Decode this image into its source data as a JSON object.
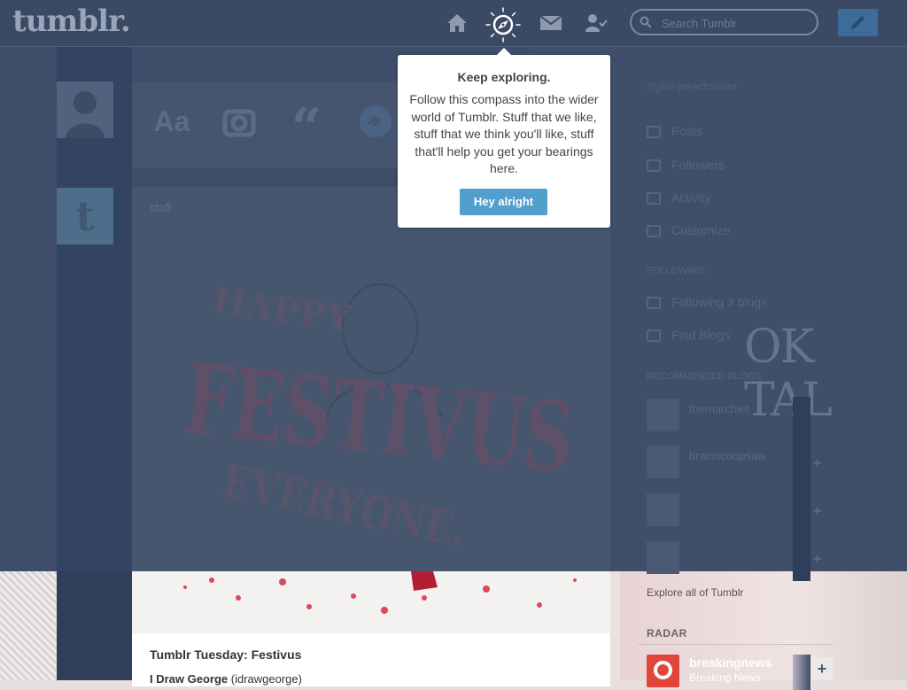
{
  "header": {
    "logo": "tumblr.",
    "search_placeholder": "Search Tumblr"
  },
  "nav": {
    "icons": [
      "home-icon",
      "explore-compass-icon",
      "messages-envelope-icon",
      "account-people-icon",
      "compose-pencil-icon"
    ]
  },
  "popover": {
    "title": "Keep exploring.",
    "body": "Follow this compass into the wider world of Tumblr. Stuff that we like, stuff that we think you'll like, stuff that'll help you get your bearings here.",
    "button": "Hey alright"
  },
  "dashboard": {
    "post_types": [
      "Aa",
      "“"
    ],
    "post": {
      "author_short": "staff",
      "image_text": [
        "HAPPY",
        "FESTIVUS",
        "EVERYONE."
      ],
      "title": "Tumblr Tuesday: Festivus",
      "author_name": "I Draw George",
      "author_handle": "(idrawgeorge)"
    }
  },
  "sidebar": {
    "blog_name": "stylishpeachsister",
    "items": [
      {
        "label": "Posts"
      },
      {
        "label": "Followers"
      },
      {
        "label": "Activity"
      },
      {
        "label": "Customize"
      }
    ],
    "section_label": "FOLLOWING",
    "following": [
      {
        "label": "Following 3 blogs"
      },
      {
        "label": "Find Blogs"
      }
    ],
    "recommended_label": "RECOMMENDED BLOGS",
    "recommended": [
      {
        "name": "themarchiet"
      },
      {
        "name": "brainscoopsaw"
      },
      {
        "name": ""
      },
      {
        "name": ""
      }
    ],
    "explore_link": "Explore all of Tumblr",
    "radar_label": "RADAR",
    "radar": {
      "name": "breakingnews",
      "sub": "Breaking News"
    }
  },
  "background_text": "OK TAL",
  "colors": {
    "topbar": "#3a4a65",
    "overlay": "#344563",
    "button_blue": "#529ecc",
    "compose": "#3d6b9a"
  }
}
